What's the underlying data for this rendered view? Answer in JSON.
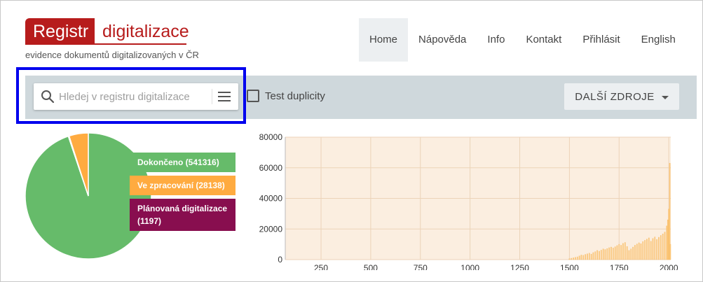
{
  "logo": {
    "box_text": "Registr",
    "word": "digitalizace",
    "subtitle": "evidence dokumentů digitalizovaných v ČR",
    "color": "#b71c1c"
  },
  "nav": {
    "items": [
      {
        "label": "Home",
        "active": true
      },
      {
        "label": "Nápověda"
      },
      {
        "label": "Info"
      },
      {
        "label": "Kontakt"
      },
      {
        "label": "Přihlásit"
      },
      {
        "label": "English"
      }
    ]
  },
  "search": {
    "placeholder": "Hledej v registru digitalizace",
    "value": "",
    "icon": "search-icon",
    "menu_icon": "hamburger-menu-icon"
  },
  "duplicity": {
    "label": "Test duplicity",
    "checked": false
  },
  "more_sources": {
    "label": "DALŠÍ ZDROJE",
    "icon": "caret-down-icon"
  },
  "chart_data": [
    {
      "type": "pie",
      "slices": [
        {
          "label": "Dokončeno (541316)",
          "value": 541316,
          "color": "#66bb6a"
        },
        {
          "label": "Ve zpracování (28138)",
          "value": 28138,
          "color": "#ffab40"
        },
        {
          "label": "Plánovaná digitalizace (1197)",
          "value": 1197,
          "color": "#880e4f"
        }
      ],
      "legend_position": "right"
    },
    {
      "type": "bar",
      "xlim": [
        70,
        2010
      ],
      "ylim": [
        0,
        80000
      ],
      "x_ticks": [
        250,
        500,
        750,
        1000,
        1250,
        1500,
        1750,
        2000
      ],
      "y_ticks": [
        0,
        20000,
        40000,
        60000,
        80000
      ],
      "grid": true,
      "bar_color": "#ffcc80",
      "bg_color": "#fbeee0",
      "x": [
        1500,
        1510,
        1520,
        1530,
        1540,
        1550,
        1560,
        1570,
        1580,
        1590,
        1600,
        1610,
        1620,
        1630,
        1640,
        1650,
        1660,
        1670,
        1680,
        1690,
        1700,
        1710,
        1720,
        1730,
        1740,
        1750,
        1760,
        1770,
        1780,
        1790,
        1800,
        1810,
        1820,
        1830,
        1840,
        1850,
        1860,
        1870,
        1880,
        1890,
        1900,
        1910,
        1920,
        1930,
        1940,
        1950,
        1960,
        1970,
        1980,
        1990,
        1995,
        2000,
        2005,
        2008
      ],
      "values": [
        600,
        900,
        1200,
        1500,
        1800,
        2400,
        3000,
        2800,
        3400,
        3800,
        4200,
        3600,
        4600,
        5200,
        6000,
        5500,
        6200,
        7000,
        6600,
        7200,
        7800,
        8200,
        7600,
        8400,
        9200,
        10000,
        9400,
        10600,
        11200,
        8600,
        6000,
        7000,
        8200,
        9400,
        10200,
        11000,
        10400,
        11800,
        12600,
        13400,
        14200,
        12000,
        13800,
        14800,
        13200,
        14600,
        15800,
        16800,
        18000,
        22000,
        26000,
        33000,
        63000,
        10000
      ]
    }
  ]
}
